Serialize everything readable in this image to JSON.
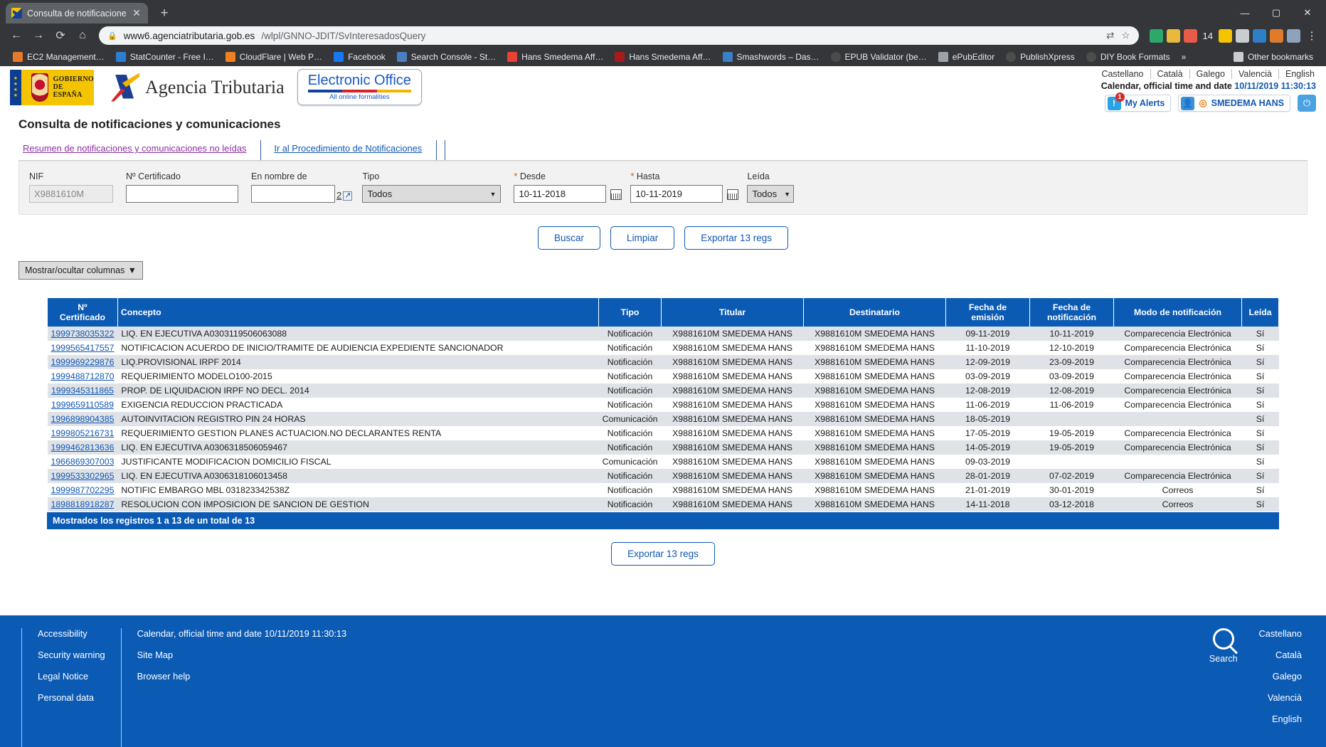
{
  "browser": {
    "tab_title": "Consulta de notificaciones y com",
    "close_glyph": "✕",
    "newtab_glyph": "+",
    "back_glyph": "←",
    "forward_glyph": "→",
    "reload_glyph": "⟳",
    "home_glyph": "⌂",
    "lock_glyph": "🔒",
    "url_host": "www6.agenciatributaria.gob.es",
    "url_path": "/wlpl/GNNO-JDIT/SvInteresadosQuery",
    "star_glyph": "☆",
    "translate_glyph": "⇄",
    "ext_count": "14",
    "kebab_glyph": "⋮",
    "win_min": "—",
    "win_max": "▢",
    "win_close": "✕",
    "bookmarks": [
      {
        "label": "EC2 Management…",
        "color": "#e8792b"
      },
      {
        "label": "StatCounter - Free I…",
        "color": "#2a7fd4"
      },
      {
        "label": "CloudFlare | Web P…",
        "color": "#f38020"
      },
      {
        "label": "Facebook",
        "color": "#1877f2"
      },
      {
        "label": "Search Console - St…",
        "color": "#4a7fc1"
      },
      {
        "label": "Hans Smedema Aff…",
        "color": "#e94235"
      },
      {
        "label": "Hans Smedema Aff…",
        "color": "#a61b1b"
      },
      {
        "label": "Smashwords – Das…",
        "color": "#3b7fc4"
      },
      {
        "label": "EPUB Validator (be…",
        "color": "#4c4c4c"
      },
      {
        "label": "ePubEditor",
        "color": "#9aa3ad"
      },
      {
        "label": "PublishXpress",
        "color": "#4c4c4c"
      },
      {
        "label": "DIY Book Formats",
        "color": "#4c4c4c"
      }
    ],
    "overflow_glyph": "»",
    "other_bookmarks": "Other bookmarks"
  },
  "header": {
    "gov_line1": "GOBIERNO",
    "gov_line2": "DE ESPAÑA",
    "agency_name": "Agencia Tributaria",
    "eoffice_title": "Electronic Office",
    "eoffice_sub": "All online formalities",
    "languages": [
      "Castellano",
      "Català",
      "Galego",
      "Valencià",
      "English"
    ],
    "calendar_label": "Calendar, official time and date",
    "calendar_value": "10/11/2019 11:30:13",
    "alerts_label": "My Alerts",
    "alerts_badge": "1",
    "user_name": "SMEDEMA HANS",
    "power_glyph": "⏻",
    "alert_glyph": "!",
    "user_glyph": "👤",
    "target_glyph": "◎"
  },
  "main": {
    "page_title": "Consulta de notificaciones y comunicaciones",
    "tab_links": [
      "Resumen de notificaciones y comunicaciones no leídas",
      "Ir al Procedimiento de Notificaciones"
    ],
    "form": {
      "nif_label": "NIF",
      "nif_value": "X9881610M",
      "cert_label": "Nº Certificado",
      "cert_value": "",
      "name_label": "En nombre de",
      "name_value": "",
      "help_text": "2",
      "help_ext_glyph": "↗",
      "tipo_label": "Tipo",
      "tipo_value": "Todos",
      "desde_label": "Desde",
      "desde_value": "10-11-2018",
      "hasta_label": "Hasta",
      "hasta_value": "10-11-2019",
      "leida_label": "Leída",
      "leida_value": "Todos",
      "required_mark": "*",
      "caret": "▼"
    },
    "buttons": {
      "search": "Buscar",
      "clear": "Limpiar",
      "export": "Exportar 13 regs",
      "export_bottom": "Exportar 13 regs"
    },
    "columns_toggle": "Mostrar/ocultar columnas",
    "summary": "Mostrados los registros 1 a 13 de un total de 13",
    "table": {
      "headers": [
        "Nº Certificado",
        "Concepto",
        "Tipo",
        "Titular",
        "Destinatario",
        "Fecha de emisión",
        "Fecha de notificación",
        "Modo de notificación",
        "Leída"
      ],
      "header_parts": [
        [
          "Nº",
          "Certificado"
        ],
        [
          "Concepto",
          ""
        ],
        [
          "Tipo",
          ""
        ],
        [
          "Titular",
          ""
        ],
        [
          "Destinatario",
          ""
        ],
        [
          "Fecha de",
          "emisión"
        ],
        [
          "Fecha de",
          "notificación"
        ],
        [
          "Modo de notificación",
          ""
        ],
        [
          "Leída",
          ""
        ]
      ],
      "rows": [
        {
          "cert": "1999738035322",
          "concepto": "LIQ. EN EJECUTIVA A0303119506063088",
          "tipo": "Notificación",
          "titular": "X9881610M SMEDEMA HANS",
          "dest": "X9881610M SMEDEMA HANS",
          "emision": "09-11-2019",
          "notif": "10-11-2019",
          "modo": "Comparecencia Electrónica",
          "leida": "Sí"
        },
        {
          "cert": "1999565417557",
          "concepto": "NOTIFICACION ACUERDO DE INICIO/TRAMITE DE AUDIENCIA EXPEDIENTE SANCIONADOR",
          "tipo": "Notificación",
          "titular": "X9881610M SMEDEMA HANS",
          "dest": "X9881610M SMEDEMA HANS",
          "emision": "11-10-2019",
          "notif": "12-10-2019",
          "modo": "Comparecencia Electrónica",
          "leida": "Sí"
        },
        {
          "cert": "1999969229876",
          "concepto": "LIQ.PROVISIONAL IRPF 2014",
          "tipo": "Notificación",
          "titular": "X9881610M SMEDEMA HANS",
          "dest": "X9881610M SMEDEMA HANS",
          "emision": "12-09-2019",
          "notif": "23-09-2019",
          "modo": "Comparecencia Electrónica",
          "leida": "Sí"
        },
        {
          "cert": "1999488712870",
          "concepto": "REQUERIMIENTO MODELO100-2015",
          "tipo": "Notificación",
          "titular": "X9881610M SMEDEMA HANS",
          "dest": "X9881610M SMEDEMA HANS",
          "emision": "03-09-2019",
          "notif": "03-09-2019",
          "modo": "Comparecencia Electrónica",
          "leida": "Sí"
        },
        {
          "cert": "1999345311865",
          "concepto": "PROP. DE LIQUIDACION IRPF NO DECL. 2014",
          "tipo": "Notificación",
          "titular": "X9881610M SMEDEMA HANS",
          "dest": "X9881610M SMEDEMA HANS",
          "emision": "12-08-2019",
          "notif": "12-08-2019",
          "modo": "Comparecencia Electrónica",
          "leida": "Sí"
        },
        {
          "cert": "1999659110589",
          "concepto": "EXIGENCIA REDUCCION PRACTICADA",
          "tipo": "Notificación",
          "titular": "X9881610M SMEDEMA HANS",
          "dest": "X9881610M SMEDEMA HANS",
          "emision": "11-06-2019",
          "notif": "11-06-2019",
          "modo": "Comparecencia Electrónica",
          "leida": "Sí"
        },
        {
          "cert": "1996898904385",
          "concepto": "AUTOINVITACION REGISTRO PIN 24 HORAS",
          "tipo": "Comunicación",
          "titular": "X9881610M SMEDEMA HANS",
          "dest": "X9881610M SMEDEMA HANS",
          "emision": "18-05-2019",
          "notif": "",
          "modo": "",
          "leida": "Sí"
        },
        {
          "cert": "1999805216731",
          "concepto": "REQUERIMIENTO GESTION PLANES ACTUACION.NO DECLARANTES RENTA",
          "tipo": "Notificación",
          "titular": "X9881610M SMEDEMA HANS",
          "dest": "X9881610M SMEDEMA HANS",
          "emision": "17-05-2019",
          "notif": "19-05-2019",
          "modo": "Comparecencia Electrónica",
          "leida": "Sí"
        },
        {
          "cert": "1999462813636",
          "concepto": "LIQ. EN EJECUTIVA A0306318506059467",
          "tipo": "Notificación",
          "titular": "X9881610M SMEDEMA HANS",
          "dest": "X9881610M SMEDEMA HANS",
          "emision": "14-05-2019",
          "notif": "19-05-2019",
          "modo": "Comparecencia Electrónica",
          "leida": "Sí"
        },
        {
          "cert": "1966869307003",
          "concepto": "JUSTIFICANTE MODIFICACION DOMICILIO FISCAL",
          "tipo": "Comunicación",
          "titular": "X9881610M SMEDEMA HANS",
          "dest": "X9881610M SMEDEMA HANS",
          "emision": "09-03-2019",
          "notif": "",
          "modo": "",
          "leida": "Sí"
        },
        {
          "cert": "1999533302965",
          "concepto": "LIQ. EN EJECUTIVA A0306318106013458",
          "tipo": "Notificación",
          "titular": "X9881610M SMEDEMA HANS",
          "dest": "X9881610M SMEDEMA HANS",
          "emision": "28-01-2019",
          "notif": "07-02-2019",
          "modo": "Comparecencia Electrónica",
          "leida": "Sí"
        },
        {
          "cert": "1999987702295",
          "concepto": "NOTIFIC EMBARGO MBL 031823342538Z",
          "tipo": "Notificación",
          "titular": "X9881610M SMEDEMA HANS",
          "dest": "X9881610M SMEDEMA HANS",
          "emision": "21-01-2019",
          "notif": "30-01-2019",
          "modo": "Correos",
          "leida": "Sí"
        },
        {
          "cert": "1898818918287",
          "concepto": "RESOLUCION CON IMPOSICION DE SANCION DE GESTION",
          "tipo": "Notificación",
          "titular": "X9881610M SMEDEMA HANS",
          "dest": "X9881610M SMEDEMA HANS",
          "emision": "14-11-2018",
          "notif": "03-12-2018",
          "modo": "Correos",
          "leida": "Sí"
        }
      ]
    }
  },
  "footer": {
    "col1": [
      "Accessibility",
      "Security warning",
      "Legal Notice",
      "Personal data"
    ],
    "col2": [
      "Calendar, official time and date 10/11/2019 11:30:13",
      "Site Map",
      "Browser help"
    ],
    "search_label": "Search",
    "languages": [
      "Castellano",
      "Català",
      "Galego",
      "Valencià",
      "English"
    ]
  },
  "colors": {
    "brand_blue": "#0b5bb5",
    "link_blue": "#1157b3",
    "purple_link": "#8b2fa0"
  }
}
